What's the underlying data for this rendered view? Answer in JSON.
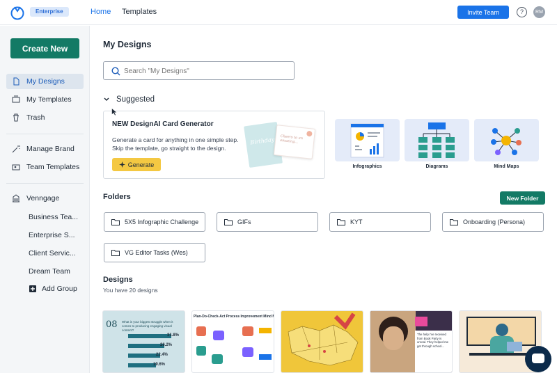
{
  "topbar": {
    "badge": "Enterprise",
    "nav_home": "Home",
    "nav_templates": "Templates",
    "invite_label": "Invite Team",
    "help_glyph": "?",
    "avatar_initials": "RM",
    "accent": "#1a73e8"
  },
  "sidebar": {
    "create_label": "Create New",
    "items": [
      {
        "label": "My Designs",
        "icon": "file-icon"
      },
      {
        "label": "My Templates",
        "icon": "template-icon"
      },
      {
        "label": "Trash",
        "icon": "trash-icon"
      },
      {
        "label": "Manage Brand",
        "icon": "magic-wand-icon"
      },
      {
        "label": "Team Templates",
        "icon": "team-template-icon"
      },
      {
        "label": "Venngage",
        "icon": "building-icon"
      }
    ],
    "groups": [
      "Business Tea...",
      "Enterprise S...",
      "Client Servic...",
      "Dream Team"
    ],
    "add_group": "Add Group",
    "brand_green": "#137a65"
  },
  "main": {
    "title": "My Designs",
    "search_placeholder": "Search \"My Designs\"",
    "suggested": "Suggested",
    "generator": {
      "title": "NEW DesignAI Card Generator",
      "desc": "Generate a card for anything in one simple step. Skip the template, go straight to the design.",
      "button": "Generate",
      "card_text": "Birthday",
      "card_text2": "Cheers to an amazing..."
    },
    "templates": [
      "Infographics",
      "Diagrams",
      "Mind Maps"
    ],
    "folders_title": "Folders",
    "new_folder": "New Folder",
    "folders": [
      "5X5 Infographic Challenge",
      "GIFs",
      "KYT",
      "Onboarding (Persona)",
      "VG Editor Tasks (Wes)"
    ],
    "designs_title": "Designs",
    "designs_count": "You have 20 designs",
    "thumb1": {
      "num": "08",
      "headline": "What is your biggest struggle when it comes to producing engaging visual content?",
      "values": [
        "31.8%",
        "26.2%",
        "22.4%",
        "19.6%"
      ]
    },
    "thumb2": {
      "title": "Plan-Do-Check-Act Process Improvement Mind Map"
    },
    "thumb4": {
      "text": "The help I've received from Book Party is unreal. They helped me get through school..."
    }
  }
}
